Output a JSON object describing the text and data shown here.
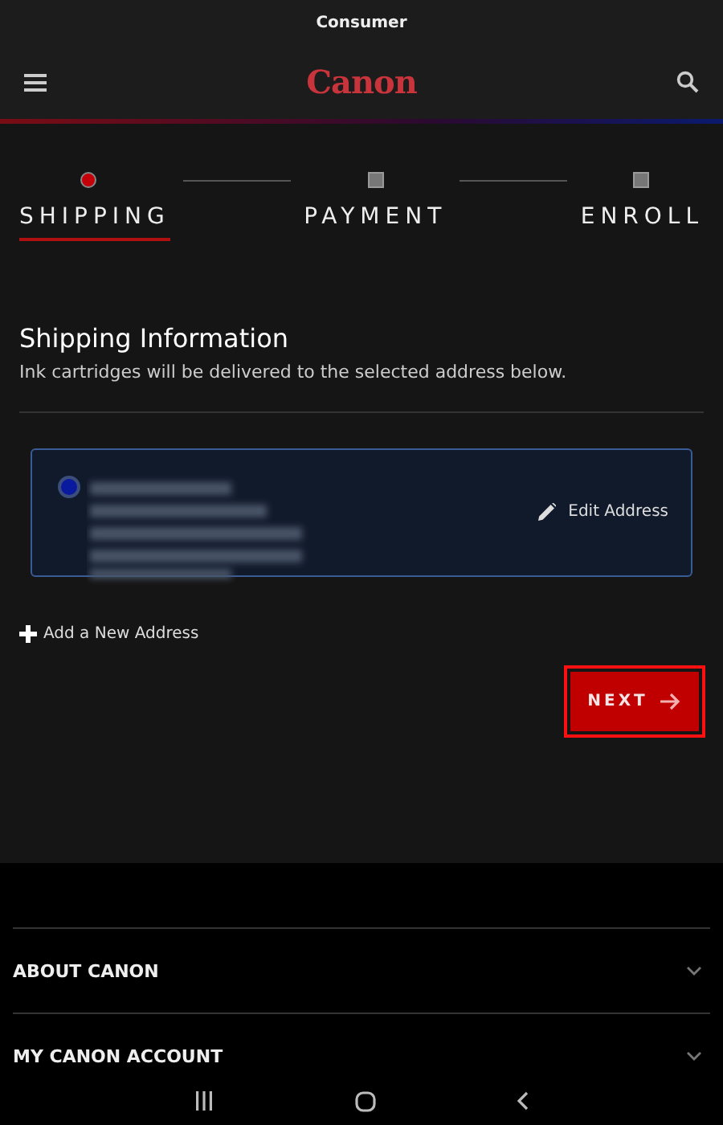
{
  "top_bar": {
    "title": "Consumer"
  },
  "header": {
    "logo": "Canon"
  },
  "steps": [
    {
      "label": "SHIPPING",
      "selected": true
    },
    {
      "label": "PAYMENT",
      "selected": false
    },
    {
      "label": "ENROLL",
      "selected": false
    }
  ],
  "section": {
    "title": "Shipping Information",
    "subtitle": "Ink cartridges will be delivered to the selected address below."
  },
  "addresses": [
    {
      "selected": true,
      "edit_label": "Edit Address"
    }
  ],
  "add_address": "Add a New Address",
  "next_button": {
    "label": "NEXT",
    "highlighted": true
  },
  "footer": {
    "items": [
      {
        "label": "ABOUT CANON",
        "expanded": false
      },
      {
        "label": "MY CANON ACCOUNT",
        "expanded": false
      }
    ]
  }
}
